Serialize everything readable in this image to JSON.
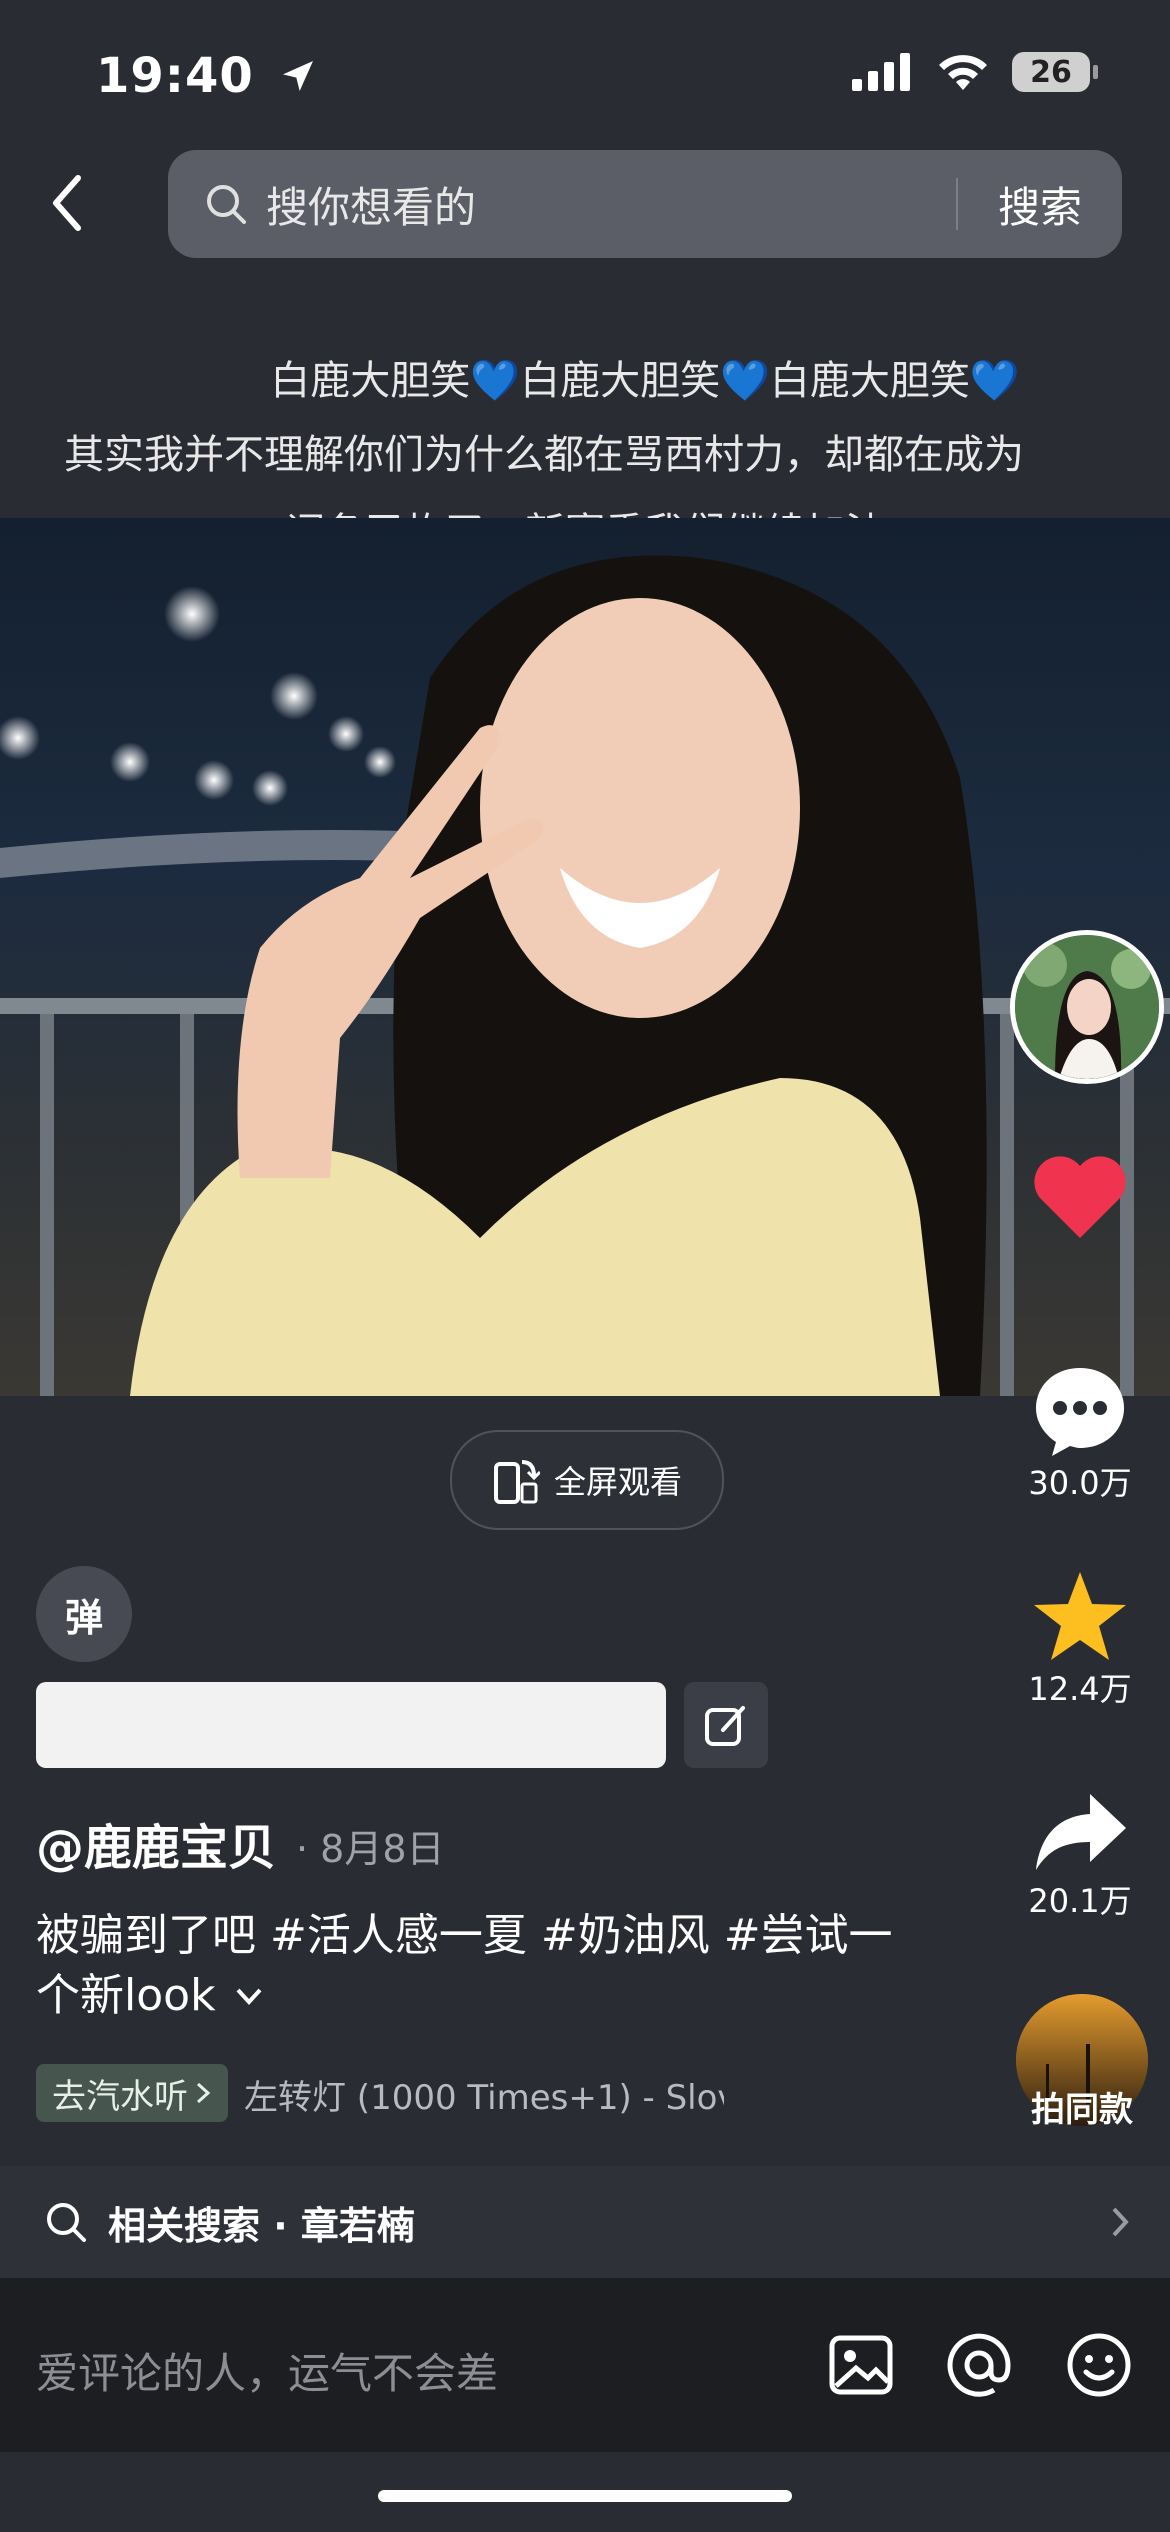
{
  "status": {
    "time": "19:40",
    "battery": "26"
  },
  "search": {
    "placeholder": "搜你想看的",
    "button": "搜索"
  },
  "danmaku": [
    "白鹿大胆笑💙白鹿大胆笑💙白鹿大胆笑💙",
    "其实我并不理解你们为什么都在骂西村力，却都在成为",
    "词条又炸了，新赛季我们继续加油"
  ],
  "video": {
    "fullscreen_label": "全屏观看"
  },
  "rail": {
    "comments": "30.0万",
    "favorites": "12.4万",
    "shares": "20.1万",
    "same_style": "拍同款"
  },
  "danmaku_button": "弹",
  "post": {
    "author": "@鹿鹿宝贝",
    "date": "· 8月8日",
    "description": "被骗到了吧 #活人感一夏 #奶油风 #尝试一个新look",
    "music_tag": "去汽水听",
    "music_name": "左转灯 (1000 Times+1) - Slov"
  },
  "related": {
    "label": "相关搜索 · 章若楠"
  },
  "comment": {
    "placeholder": "爱评论的人，运气不会差"
  },
  "colors": {
    "background": "#2a2c33",
    "like": "#f0334f",
    "favorite": "#fcbf1f"
  }
}
